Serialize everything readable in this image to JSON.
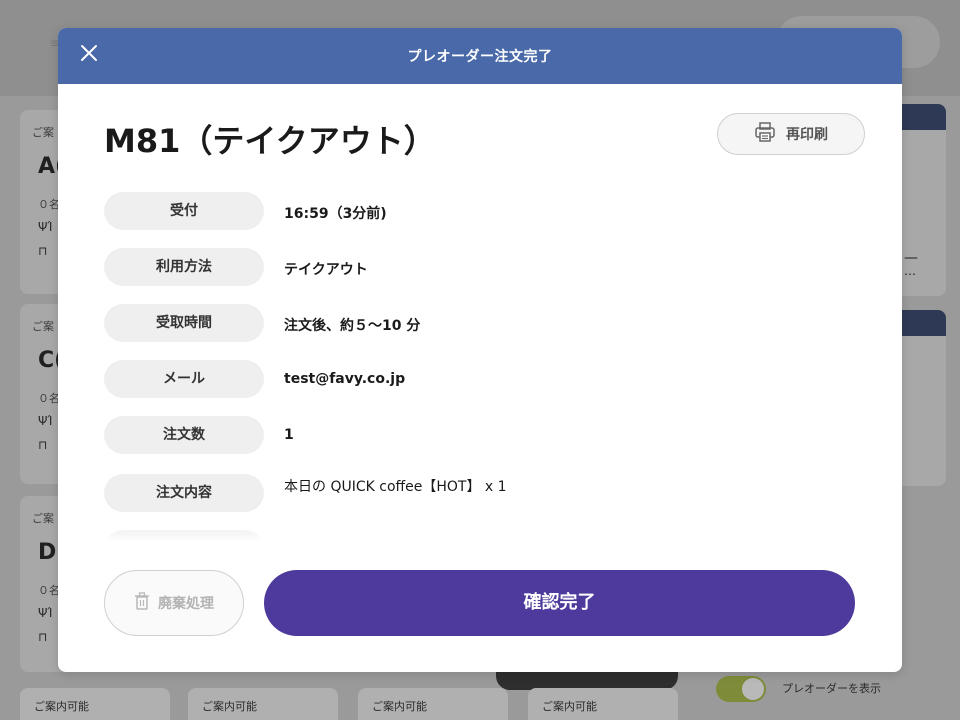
{
  "modal": {
    "title": "プレオーダー注文完了",
    "order_title": "M81（テイクアウト）",
    "reprint_label": "再印刷",
    "details": [
      {
        "label": "受付",
        "value": "16:59（3分前)"
      },
      {
        "label": "利用方法",
        "value": "テイクアウト"
      },
      {
        "label": "受取時間",
        "value": "注文後、約５〜10 分"
      },
      {
        "label": "メール",
        "value": "test@favy.co.jp"
      },
      {
        "label": "注文数",
        "value": "1"
      },
      {
        "label": "注文内容",
        "value": "本日の QUICK coffee【HOT】 x 1"
      }
    ],
    "discard_label": "廃棄処理",
    "confirm_label": "確認完了"
  },
  "background": {
    "cards": [
      {
        "caption": "ご案",
        "code": "A(",
        "count": "０名"
      },
      {
        "caption": "ご案",
        "code": "C(",
        "count": "０名"
      },
      {
        "caption": "ご案",
        "code": "D(",
        "count": "０名"
      }
    ],
    "right_dash": "—",
    "right_dots": "…",
    "bottom_tabs": [
      "ご案内可能",
      "ご案内可能",
      "ご案内可能",
      "ご案内可能"
    ],
    "toggle_label": "プレオーダーを表示"
  },
  "colors": {
    "header": "#4a69a8",
    "confirm": "#4e3a9c",
    "pill": "#efefef"
  },
  "icons": [
    "close-icon",
    "printer-icon",
    "trash-icon",
    "fork-knife-icon",
    "chair-icon"
  ]
}
